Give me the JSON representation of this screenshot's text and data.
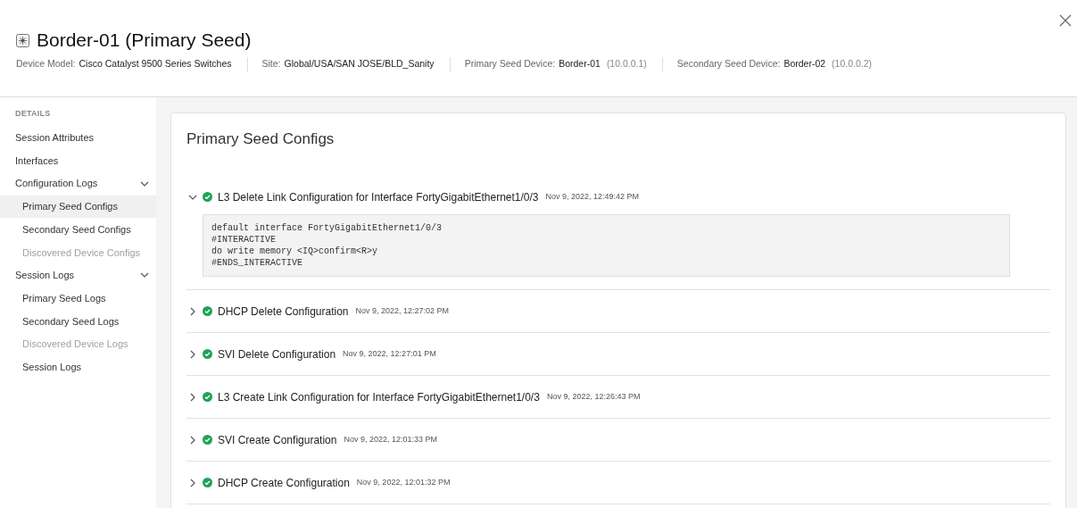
{
  "header": {
    "title": "Border-01 (Primary Seed)",
    "meta": [
      {
        "label": "Device Model:",
        "value": "Cisco Catalyst 9500 Series Switches"
      },
      {
        "label": "Site:",
        "value": "Global/USA/SAN JOSE/BLD_Sanity"
      },
      {
        "label": "Primary Seed Device:",
        "value": "Border-01",
        "note": "(10.0.0.1)"
      },
      {
        "label": "Secondary Seed Device:",
        "value": "Border-02",
        "note": "(10.0.0.2)"
      }
    ]
  },
  "sidebar": {
    "heading": "DETAILS",
    "items": [
      {
        "label": "Session Attributes",
        "selected": false,
        "disabled": false
      },
      {
        "label": "Interfaces",
        "selected": false,
        "disabled": false
      },
      {
        "label": "Configuration Logs",
        "selected": false,
        "disabled": false,
        "expanded": true,
        "children": [
          {
            "label": "Primary Seed Configs",
            "selected": true,
            "disabled": false
          },
          {
            "label": "Secondary Seed Configs",
            "selected": false,
            "disabled": false
          },
          {
            "label": "Discovered Device Configs",
            "selected": false,
            "disabled": true
          }
        ]
      },
      {
        "label": "Session Logs",
        "selected": false,
        "disabled": false,
        "expanded": true,
        "children": [
          {
            "label": "Primary Seed Logs",
            "selected": false,
            "disabled": false
          },
          {
            "label": "Secondary Seed Logs",
            "selected": false,
            "disabled": false
          },
          {
            "label": "Discovered Device Logs",
            "selected": false,
            "disabled": true
          },
          {
            "label": "Session Logs",
            "selected": false,
            "disabled": false
          }
        ]
      }
    ]
  },
  "content": {
    "title": "Primary Seed Configs",
    "logs": [
      {
        "title": "L3 Delete Link Configuration for Interface FortyGigabitEthernet1/0/3",
        "time": "Nov 9, 2022, 12:49:42 PM",
        "succeeded": true,
        "expanded": true,
        "code": [
          "default interface FortyGigabitEthernet1/0/3",
          "#INTERACTIVE",
          "do write memory <IQ>confirm<R>y",
          "#ENDS_INTERACTIVE"
        ]
      },
      {
        "title": "DHCP Delete Configuration",
        "time": "Nov 9, 2022, 12:27:02 PM",
        "succeeded": true,
        "expanded": false
      },
      {
        "title": "SVI Delete Configuration",
        "time": "Nov 9, 2022, 12:27:01 PM",
        "succeeded": true,
        "expanded": false
      },
      {
        "title": "L3 Create Link Configuration for Interface FortyGigabitEthernet1/0/3",
        "time": "Nov 9, 2022, 12:26:43 PM",
        "succeeded": true,
        "expanded": false
      },
      {
        "title": "SVI Create Configuration",
        "time": "Nov 9, 2022, 12:01:33 PM",
        "succeeded": true,
        "expanded": false
      },
      {
        "title": "DHCP Create Configuration",
        "time": "Nov 9, 2022, 12:01:32 PM",
        "succeeded": true,
        "expanded": false
      }
    ]
  }
}
